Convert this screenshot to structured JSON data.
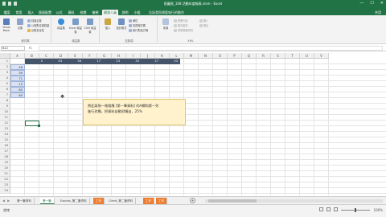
{
  "titlebar": {
    "title": "貼圖頁_108 活動年度報表.xlsm - Excel",
    "min": "—",
    "max": "☐",
    "close": "✕"
  },
  "tabs": [
    {
      "label": "檔案"
    },
    {
      "label": "常用"
    },
    {
      "label": "插入"
    },
    {
      "label": "版面配置"
    },
    {
      "label": "公式"
    },
    {
      "label": "資料"
    },
    {
      "label": "校閱"
    },
    {
      "label": "檢視"
    },
    {
      "label": "開發人員"
    },
    {
      "label": "說明"
    },
    {
      "label": "小組"
    }
  ],
  "active_tab_index": 8,
  "tell_me": "告訴我您想要執行的動作",
  "share_label": "共用",
  "ribbon": {
    "groups": [
      {
        "label": "程式碼"
      },
      {
        "label": "增益集"
      },
      {
        "label": "控制項"
      },
      {
        "label": "XML"
      }
    ],
    "visual_basic": "Visual Basic",
    "macros": "巨集",
    "record_macro": "錄製巨集",
    "relative_ref": "以相對位置錄製",
    "macro_security": "巨集安全性",
    "addins": "增益集",
    "excel_addins": "Excel 增益集",
    "com_addins": "COM 增益集",
    "insert": "插入",
    "design_mode": "設計模式",
    "properties": "屬性",
    "view_code": "檢視程式碼",
    "run_dialog": "執行對話方塊",
    "source": "來源",
    "map_properties": "對應內容",
    "expansion_packs": "擴充套件",
    "refresh_data": "重新整理資料",
    "import": "匯入",
    "export": "匯出"
  },
  "formula_bar": {
    "name_box": "B12",
    "fx": "fx",
    "formula": ""
  },
  "columns": [
    "A",
    "B",
    "C",
    "D",
    "E",
    "F",
    "G",
    "H",
    "I",
    "J",
    "K",
    "L",
    "M",
    "N",
    "O",
    "P",
    "Q",
    "R",
    "S",
    "T",
    "U",
    "V"
  ],
  "rows": [
    "1",
    "2",
    "3",
    "4",
    "5",
    "6",
    "7",
    "8",
    "9",
    "10",
    "11",
    "12",
    "13",
    "14",
    "15",
    "16",
    "17",
    "18",
    "19",
    "20",
    "21",
    "22",
    "23",
    "24"
  ],
  "header_row": [
    "5",
    "43",
    "56",
    "17",
    "23",
    "33",
    "27",
    "53"
  ],
  "data_column": [
    "48",
    "39",
    "71",
    "15",
    "85",
    "65"
  ],
  "note": {
    "line1": "將此兩張一格相應 [第一筆資料] 的A欄和第一列",
    "line2": "進行對應，把資料自動對應出，25%"
  },
  "sheets": [
    {
      "label": "第一筆資料"
    },
    {
      "label": "第一筆"
    },
    {
      "label": "Exodus_第二筆資料"
    },
    {
      "label": "工作"
    },
    {
      "label": "Client_第二筆資料"
    },
    {
      "label": "工作"
    },
    {
      "label": "工作"
    }
  ],
  "active_sheet_index": 1,
  "orange_sheet_indices": [
    3,
    5,
    6
  ],
  "status": {
    "ready": "就緒",
    "zoom": "100%"
  },
  "zoom_percent": 100,
  "colors": {
    "excel_green": "#217346",
    "header_fill": "#44546a",
    "data_fill": "#d9e1f2",
    "note_fill": "#fff2cc",
    "sheet_orange": "#ed7d31"
  }
}
